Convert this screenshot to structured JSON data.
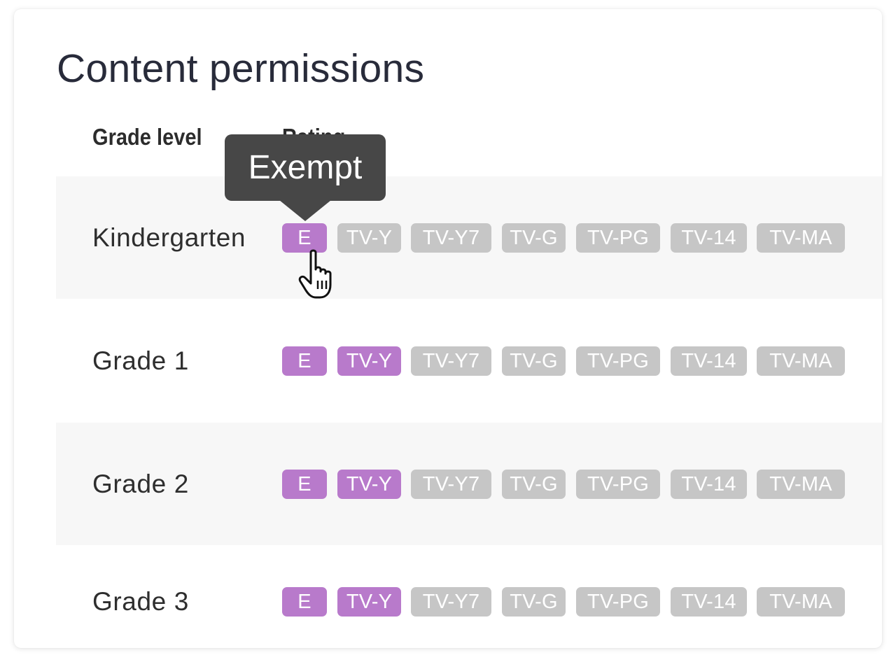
{
  "page": {
    "title": "Content permissions"
  },
  "table": {
    "columns": [
      "Grade level",
      "Rating"
    ],
    "ratings": [
      "E",
      "TV-Y",
      "TV-Y7",
      "TV-G",
      "TV-PG",
      "TV-14",
      "TV-MA"
    ],
    "rows": [
      {
        "grade": "Kindergarten",
        "enabled": [
          "E"
        ]
      },
      {
        "grade": "Grade 1",
        "enabled": [
          "E",
          "TV-Y"
        ]
      },
      {
        "grade": "Grade 2",
        "enabled": [
          "E",
          "TV-Y"
        ]
      },
      {
        "grade": "Grade 3",
        "enabled": [
          "E",
          "TV-Y"
        ]
      }
    ]
  },
  "tooltip": {
    "text": "Exempt"
  },
  "colors": {
    "chip_enabled": "#b87acb",
    "chip_disabled": "#c6c6c6",
    "tooltip_bg": "#474747",
    "row_shade": "#f7f7f7",
    "title_text": "#282b3a"
  },
  "icons": {
    "cursor": "hand-pointer-icon"
  }
}
